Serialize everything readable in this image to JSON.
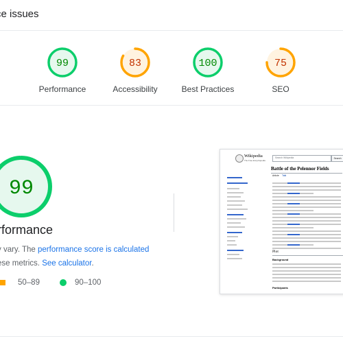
{
  "header": {
    "title": "ce issues"
  },
  "gauges": [
    {
      "label": "Performance",
      "score": "99",
      "fraction": 0.99,
      "color": "#0cce6b",
      "bg": "#e6f8ee",
      "text": "#008800"
    },
    {
      "label": "Accessibility",
      "score": "83",
      "fraction": 0.83,
      "color": "#ffa400",
      "bg": "#fff3e0",
      "text": "#c33300"
    },
    {
      "label": "Best Practices",
      "score": "100",
      "fraction": 1.0,
      "color": "#0cce6b",
      "bg": "#e6f8ee",
      "text": "#008800"
    },
    {
      "label": "SEO",
      "score": "75",
      "fraction": 0.75,
      "color": "#ffa400",
      "bg": "#fff3e0",
      "text": "#c33300"
    }
  ],
  "main": {
    "score": "99",
    "fraction": 0.99,
    "title": "erformance",
    "desc_line1_prefix": "y vary. The ",
    "desc_link1": "performance score is calculated",
    "desc_line2_prefix": "ese metrics. ",
    "desc_link2": "See calculator",
    "desc_line2_suffix": ".",
    "legend_mid": "50–89",
    "legend_high": "90–100"
  },
  "wiki": {
    "logo_title": "Wikipedia",
    "logo_sub": "The Free Encyclopedia",
    "search_placeholder": "Search Wikipedia",
    "search_btn": "Search",
    "article_title": "Battle of the Pelennor Fields",
    "tab_article": "Article",
    "tab_talk": "Talk",
    "section_plot": "Plot",
    "section_background": "Background",
    "section_participants": "Participants"
  },
  "colors": {
    "link": "#1a73e8",
    "pass": "#0cce6b",
    "average": "#ffa400"
  }
}
